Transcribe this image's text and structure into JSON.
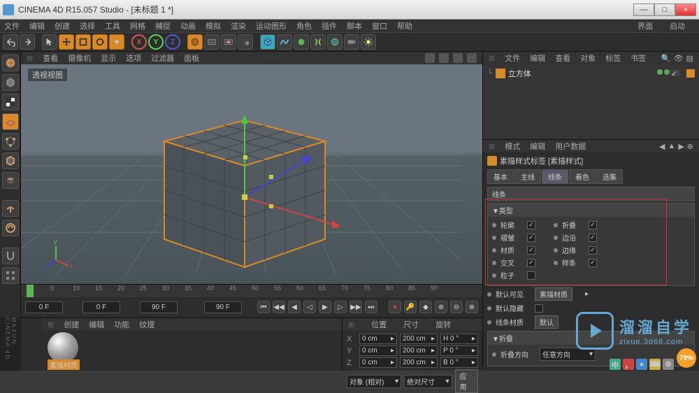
{
  "window": {
    "title": "CINEMA 4D R15.057 Studio - [未标题 1 *]",
    "min": "—",
    "max": "□",
    "close": "×"
  },
  "menu": {
    "items": [
      "文件",
      "编辑",
      "创建",
      "选择",
      "工具",
      "网格",
      "捕捉",
      "动画",
      "模拟",
      "渲染",
      "运动图形",
      "角色",
      "插件",
      "脚本",
      "窗口",
      "帮助"
    ],
    "right": [
      "界面",
      "启动"
    ]
  },
  "viewheader": {
    "items": [
      "查看",
      "摄像机",
      "显示",
      "选项",
      "过滤器",
      "面板"
    ]
  },
  "viewport": {
    "label": "透视视图"
  },
  "object_manager": {
    "tabs": [
      "文件",
      "编辑",
      "查看",
      "对象",
      "标签",
      "书签"
    ],
    "item": "立方体"
  },
  "attr": {
    "tabs": [
      "模式",
      "编辑",
      "用户数据"
    ],
    "title": "素描样式标签 [素描样式]",
    "subtabs": [
      "基本",
      "主线",
      "线条",
      "着色",
      "选集"
    ],
    "active_subtab": "线条",
    "section1": "线条",
    "section2": "▼类型",
    "rows": [
      {
        "l": "轮廓",
        "c1": true,
        "r": "折叠",
        "c2": true
      },
      {
        "l": "褶皱",
        "c1": true,
        "r": "边沿",
        "c2": true
      },
      {
        "l": "材质",
        "c1": true,
        "r": "边缘",
        "c2": true
      },
      {
        "l": "交叉",
        "c1": true,
        "r": "样条",
        "c2": true
      },
      {
        "l": "粒子",
        "c1": false,
        "r": "",
        "c2": false
      }
    ],
    "vis_default": "默认可见",
    "vis_mat": "素描材质",
    "hide_default": "默认隐藏",
    "line_mat": "线条材质",
    "line_mat_val": "默认",
    "fold": "▼折叠",
    "fold_dir": "折叠方向",
    "fold_any": "任意方向"
  },
  "timeline": {
    "start": "0 F",
    "cur": "0 F",
    "end": "90 F",
    "end2": "90 F",
    "ticks": [
      "0",
      "5",
      "10",
      "15",
      "20",
      "25",
      "30",
      "35",
      "40",
      "45",
      "50",
      "55",
      "60",
      "65",
      "70",
      "75",
      "80",
      "85",
      "90"
    ]
  },
  "materials": {
    "tabs": [
      "创建",
      "编辑",
      "功能",
      "纹理"
    ],
    "name": "素描材质"
  },
  "coords": {
    "headers": [
      "位置",
      "尺寸",
      "旋转"
    ],
    "rows": [
      {
        "axis": "X",
        "p": "0 cm",
        "s": "200 cm",
        "r": "H 0 °"
      },
      {
        "axis": "Y",
        "p": "0 cm",
        "s": "200 cm",
        "r": "P 0 °"
      },
      {
        "axis": "Z",
        "p": "0 cm",
        "s": "200 cm",
        "r": "B 0 °"
      }
    ],
    "obj": "对象 (相对)",
    "abs": "绝对尺寸",
    "apply": "应用"
  },
  "watermark": {
    "cn": "溜溜自学",
    "url": "zixue.3d66.com"
  },
  "pct": "79%"
}
